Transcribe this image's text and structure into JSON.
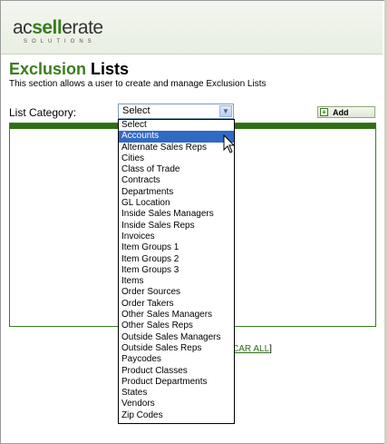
{
  "header": {
    "logo_text_pre": "ac",
    "logo_text_accent": "sell",
    "logo_text_post": "erate",
    "logo_sub": "SOLUTIONS"
  },
  "page": {
    "title_accent": "Exclusion",
    "title_rest": " Lists",
    "subtitle": "This section allows a user to create and manage Exclusion Lists"
  },
  "category": {
    "label": "List Category:",
    "selected_value": "Select",
    "options": [
      "Select",
      "Accounts",
      "Alternate Sales Reps",
      "Cities",
      "Class of Trade",
      "Contracts",
      "Departments",
      "GL Location",
      "Inside Sales Managers",
      "Inside Sales Reps",
      "Invoices",
      "Item Groups 1",
      "Item Groups 2",
      "Item Groups 3",
      "Items",
      "Order Sources",
      "Order Takers",
      "Other Sales Managers",
      "Other Sales Reps",
      "Outside Sales Managers",
      "Outside Sales Reps",
      "Paycodes",
      "Product Classes",
      "Product Departments",
      "States",
      "Vendors",
      "Zip Codes"
    ],
    "highlighted_option": "Accounts"
  },
  "toolbar": {
    "add_label": "Add"
  },
  "footer": {
    "clear_all_link": "CAR ALL",
    "clear_all_bracket": "]"
  },
  "colors": {
    "brand_green": "#3a7d1c",
    "selection_blue": "#316ac5"
  }
}
